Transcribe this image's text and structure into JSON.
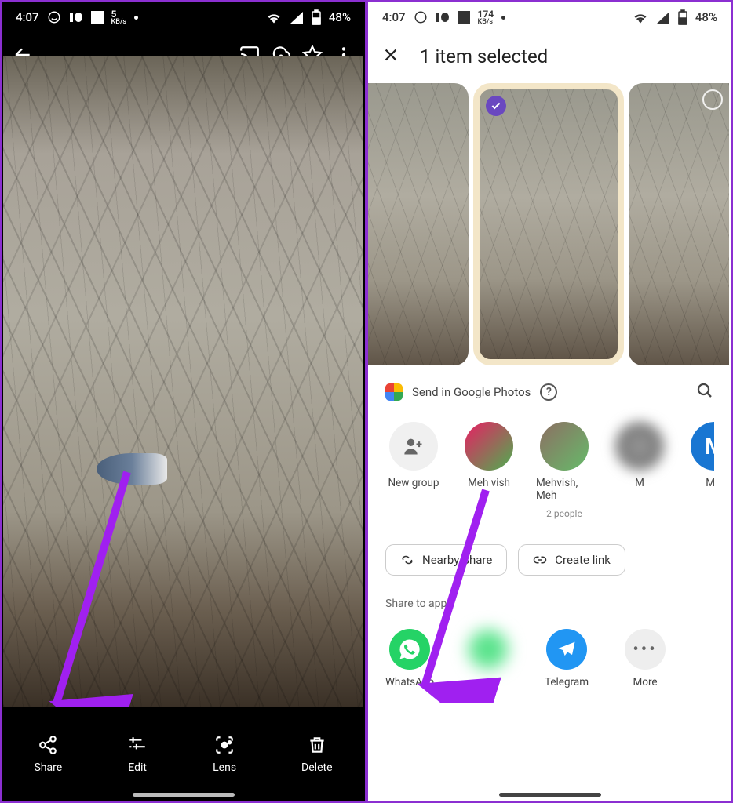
{
  "statusbar": {
    "time": "4:07",
    "data_rate_left": {
      "num": "5",
      "unit": "KB/s"
    },
    "data_rate_right": {
      "num": "174",
      "unit": "KB/s"
    },
    "battery": "48%"
  },
  "left_screen": {
    "bottom": {
      "share": "Share",
      "edit": "Edit",
      "lens": "Lens",
      "delete": "Delete"
    }
  },
  "right_screen": {
    "header": {
      "title": "1 item selected"
    },
    "send_label": "Send in Google Photos",
    "contacts": [
      {
        "name": "New group",
        "sub": ""
      },
      {
        "name": "Meh vish",
        "sub": ""
      },
      {
        "name": "Mehvish, Meh",
        "sub": "2 people"
      },
      {
        "name": "M",
        "sub": ""
      },
      {
        "name": "MM",
        "sub": ""
      }
    ],
    "chips": {
      "nearby": "Nearby Share",
      "createlink": "Create link"
    },
    "share_apps_label": "Share to apps",
    "apps": {
      "whatsapp": "WhatsApp",
      "telegram": "Telegram",
      "more": "More"
    }
  }
}
